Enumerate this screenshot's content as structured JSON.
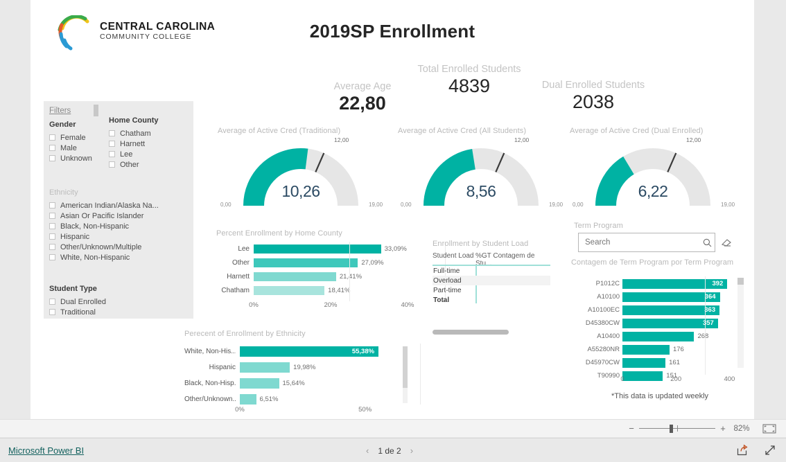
{
  "brand": {
    "name_line1": "CENTRAL CAROLINA",
    "name_line2": "COMMUNITY COLLEGE",
    "logo_colors": [
      "#e35b2a",
      "#2a9ad4",
      "#3aab4a",
      "#f0c419",
      "#e35b2a"
    ],
    "accent": "#00B2A3"
  },
  "report": {
    "title": "2019SP Enrollment",
    "weekly_note": "*This data is updated weekly"
  },
  "filters": {
    "pane_title": "Filters",
    "groups": [
      {
        "title": "Gender",
        "items": [
          "Female",
          "Male",
          "Unknown"
        ]
      },
      {
        "title": "Home County",
        "items": [
          "Chatham",
          "Harnett",
          "Lee",
          "Other"
        ]
      },
      {
        "title": "Ethnicity",
        "items": [
          "American Indian/Alaska Na...",
          "Asian Or Pacific Islander",
          "Black, Non-Hispanic",
          "Hispanic",
          "Other/Unknown/Multiple",
          "White, Non-Hispanic"
        ]
      },
      {
        "title": "Student Type",
        "items": [
          "Dual Enrolled",
          "Traditional"
        ]
      }
    ]
  },
  "kpis": [
    {
      "label": "Average Age",
      "value": "22,80"
    },
    {
      "label": "Total Enrolled Students",
      "value": "4839"
    },
    {
      "label": "Dual Enrolled Students",
      "value": "2038"
    }
  ],
  "gauges": [
    {
      "title": "Average of Active Cred (Traditional)",
      "value": "10,26",
      "value_num": 10.26,
      "min": "0,00",
      "max": "19,00",
      "target": "12,00",
      "min_num": 0,
      "max_num": 19,
      "target_num": 12
    },
    {
      "title": "Average of Active Cred (All Students)",
      "value": "8,56",
      "value_num": 8.56,
      "min": "0,00",
      "max": "19,00",
      "target": "12,00",
      "min_num": 0,
      "max_num": 19,
      "target_num": 12
    },
    {
      "title": "Average of Active Cred (Dual Enrolled)",
      "value": "6,22",
      "value_num": 6.22,
      "min": "0,00",
      "max": "19,00",
      "target": "12,00",
      "min_num": 0,
      "max_num": 19,
      "target_num": 12
    }
  ],
  "chart_data": [
    {
      "id": "county",
      "type": "bar",
      "orientation": "horizontal",
      "title": "Percent Enrollment by Home County",
      "categories": [
        "Lee",
        "Other",
        "Harnett",
        "Chatham"
      ],
      "values": [
        33.09,
        27.09,
        21.41,
        18.41
      ],
      "value_labels": [
        "33,09%",
        "27,09%",
        "21,41%",
        "18,41%"
      ],
      "colors": [
        "#00B2A3",
        "#3ec8bb",
        "#7fd9d0",
        "#a8e4dd"
      ],
      "xlabel": "",
      "ylabel": "",
      "xlim": [
        0,
        40
      ],
      "ticks": [
        "0%",
        "20%",
        "40%"
      ],
      "tick_values": [
        0,
        20,
        40
      ],
      "grid": true,
      "legend": "none"
    },
    {
      "id": "ethnicity",
      "type": "bar",
      "orientation": "horizontal",
      "title": "Perecent of Enrollment by Ethnicity",
      "categories": [
        "White, Non-His...",
        "Hispanic",
        "Black, Non-Hisp...",
        "Other/Unknown..."
      ],
      "values": [
        55.38,
        19.98,
        15.64,
        6.51
      ],
      "value_labels": [
        "55,38%",
        "19,98%",
        "15,64%",
        "6,51%"
      ],
      "colors": [
        "#00B2A3",
        "#7fd9d0",
        "#7fd9d0",
        "#7fd9d0"
      ],
      "xlabel": "",
      "ylabel": "",
      "xlim": [
        0,
        62
      ],
      "ticks": [
        "0%",
        "50%"
      ],
      "tick_values": [
        0,
        50
      ],
      "grid": true,
      "legend": "none"
    },
    {
      "id": "term_program",
      "type": "bar",
      "orientation": "horizontal",
      "title": "Contagem de Term Program por Term Program",
      "categories": [
        "P1012C",
        "A10100",
        "A10100EC",
        "D45380CW",
        "A10400",
        "A55280NR",
        "D45970CW",
        "T90990"
      ],
      "values": [
        392,
        364,
        363,
        357,
        268,
        176,
        161,
        151
      ],
      "value_labels": [
        "392",
        "364",
        "363",
        "357",
        "268",
        "176",
        "161",
        "151"
      ],
      "color": "#00B2A3",
      "xlabel": "",
      "ylabel": "",
      "xlim": [
        0,
        430
      ],
      "ticks": [
        "0",
        "200",
        "400"
      ],
      "tick_values": [
        0,
        200,
        400
      ],
      "grid": true,
      "legend": "none"
    },
    {
      "id": "student_load",
      "type": "table",
      "title": "Enrollment  by Student Load",
      "columns": [
        "Student Load",
        "%GT Contagem de Stu..."
      ],
      "rows": [
        {
          "cells": [
            "Full-time",
            ""
          ]
        },
        {
          "cells": [
            "Overload",
            ""
          ]
        },
        {
          "cells": [
            "Part-time",
            ""
          ]
        },
        {
          "cells": [
            "Total",
            ""
          ]
        }
      ]
    }
  ],
  "term_slicer": {
    "title": "Term Program",
    "search_placeholder": "Search",
    "search_value": ""
  },
  "zoom_bar": {
    "minus": "−",
    "plus": "+",
    "percent": "82%"
  },
  "footer": {
    "powerbi_label": "Microsoft Power BI",
    "page_indicator": "1 de 2",
    "prev": "‹",
    "next": "›"
  }
}
